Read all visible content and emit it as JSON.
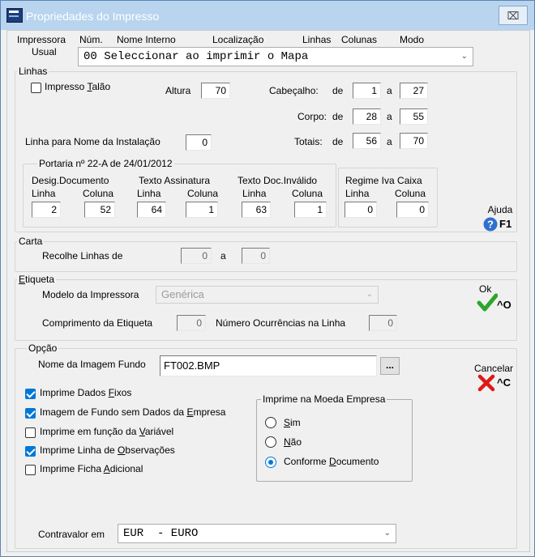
{
  "window": {
    "title": "Propriedades do Impresso",
    "close_glyph": "⌧"
  },
  "header": {
    "col_impressora": "Impressora",
    "col_usual": "Usual",
    "col_num": "Núm.",
    "col_nome": "Nome Interno",
    "col_local": "Localização",
    "col_linhas": "Linhas",
    "col_colunas": "Colunas",
    "col_modo": "Modo",
    "selected": "00 Seleccionar ao imprimir o Mapa"
  },
  "linhas": {
    "legend": "Linhas",
    "talao_label": "Impresso Talão",
    "altura_label": "Altura",
    "altura": "70",
    "cabecalho_label": "Cabeçalho:",
    "de": "de",
    "a": "a",
    "cab_de": "1",
    "cab_a": "27",
    "corpo_label": "Corpo:",
    "corpo_de": "28",
    "corpo_a": "55",
    "totais_label": "Totais:",
    "tot_de": "56",
    "tot_a": "70",
    "instalacao_label": "Linha para Nome da Instalação",
    "instalacao": "0"
  },
  "portaria": {
    "legend": "Portaria nº 22-A de 24/01/2012",
    "desig": "Desig.Documento",
    "assin": "Texto Assinatura",
    "invalido": "Texto Doc.Inválido",
    "linha": "Linha",
    "coluna": "Coluna",
    "v1": "2",
    "v2": "52",
    "v3": "64",
    "v4": "1",
    "v5": "63",
    "v6": "1"
  },
  "regime": {
    "title": "Regime Iva Caixa",
    "linha": "Linha",
    "coluna": "Coluna",
    "v1": "0",
    "v2": "0"
  },
  "carta": {
    "legend": "Carta",
    "label": "Recolhe Linhas de",
    "de": "0",
    "a_label": "a",
    "a": "0"
  },
  "etiqueta": {
    "legend": "Etiqueta",
    "modelo_label": "Modelo da Impressora",
    "modelo": "Genérica",
    "comp_label": "Comprimento da Etiqueta",
    "comp": "0",
    "ocorr_label": "Número Ocurrências na Linha",
    "ocorr": "0"
  },
  "opcao": {
    "legend": "Opção",
    "imagem_label": "Nome da Imagem Fundo",
    "imagem": "FT002.BMP",
    "browse": "...",
    "checks": [
      {
        "label": "Imprime Dados Fixos",
        "checked": true
      },
      {
        "label": "Imagem de Fundo sem Dados da Empresa",
        "checked": true
      },
      {
        "label": "Imprime em função da Variável",
        "checked": false
      },
      {
        "label": "Imprime Linha de Observações",
        "checked": true
      },
      {
        "label": "Imprime Ficha Adicional",
        "checked": false
      }
    ],
    "moeda_legend": "Imprime na Moeda Empresa",
    "radios": [
      {
        "label": "Sim",
        "selected": false
      },
      {
        "label": "Não",
        "selected": false
      },
      {
        "label": "Conforme Documento",
        "selected": true
      }
    ],
    "contravalor_label": "Contravalor em",
    "contravalor": "EUR  - EURO"
  },
  "actions": {
    "ajuda": "Ajuda",
    "ajuda_key": "F1",
    "ok": "Ok",
    "ok_key": "^O",
    "cancelar": "Cancelar",
    "cancelar_key": "^C",
    "colors": {
      "help": "#2f6fd0",
      "ok": "#2ca52c",
      "cancel": "#e01818"
    },
    "icons": [
      "help-icon",
      "checkmark-icon",
      "cross-icon"
    ]
  }
}
